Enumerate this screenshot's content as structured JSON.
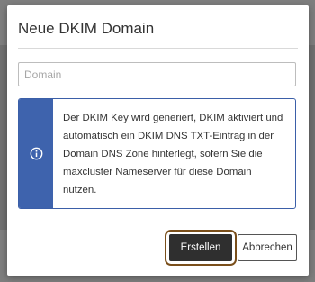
{
  "dialog": {
    "title": "Neue DKIM Domain",
    "domain_input": {
      "value": "",
      "placeholder": "Domain"
    },
    "info": {
      "icon": "info-icon",
      "text": "Der DKIM Key wird generiert, DKIM aktiviert und automatisch ein DKIM DNS TXT-Eintrag in der Domain DNS Zone hinterlegt, sofern Sie die maxcluster Nameserver für diese Domain nutzen."
    },
    "buttons": {
      "create": "Erstellen",
      "cancel": "Abbrechen"
    }
  },
  "colors": {
    "info_accent": "#3e63ad",
    "primary_button": "#2f2f2f",
    "overlay": "#707070"
  }
}
